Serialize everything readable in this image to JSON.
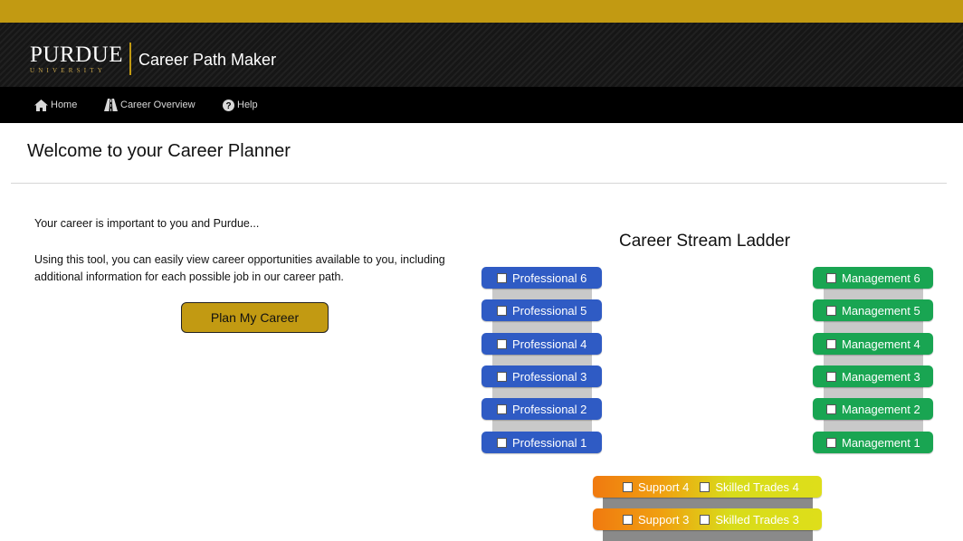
{
  "header": {
    "logo_word": "PURDUE",
    "logo_sub": "UNIVERSITY",
    "app_title": "Career Path Maker",
    "gold_color": "#c29a12"
  },
  "nav": {
    "items": [
      {
        "label": "Home",
        "icon": "home-icon"
      },
      {
        "label": "Career Overview",
        "icon": "road-icon"
      },
      {
        "label": "Help",
        "icon": "question-circle-icon"
      }
    ]
  },
  "main": {
    "title": "Welcome to your Career Planner",
    "intro": "Your career is important to you and Purdue...",
    "description": "Using this tool, you can easily view career opportunities available to you, including additional information for each possible job in our career path.",
    "plan_button": "Plan My Career"
  },
  "ladder": {
    "title": "Career Stream Ladder",
    "professional": [
      "Professional 6",
      "Professional 5",
      "Professional 4",
      "Professional 3",
      "Professional 2",
      "Professional 1"
    ],
    "management": [
      "Management 6",
      "Management 5",
      "Management 4",
      "Management 3",
      "Management 2",
      "Management 1"
    ],
    "support": [
      "Support 4",
      "Support 3"
    ],
    "skilled_trades": [
      "Skilled Trades 4",
      "Skilled Trades 3"
    ],
    "colors": {
      "professional": "#2f5bc4",
      "management": "#19a552",
      "support": "#f07a10",
      "skilled_trades": "#dede1a"
    }
  }
}
